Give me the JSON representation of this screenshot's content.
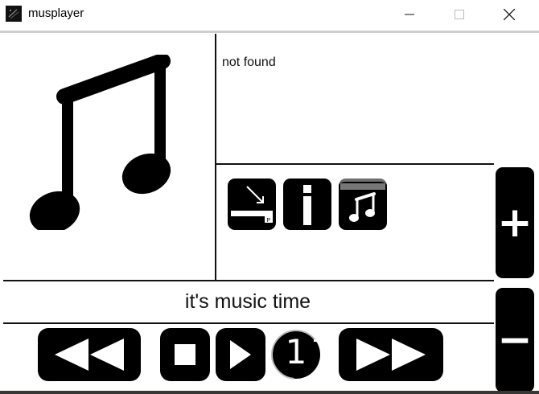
{
  "window": {
    "title": "musplayer"
  },
  "track_info": {
    "status": "not found"
  },
  "caption": "it's music time",
  "playback": {
    "counter": "1"
  },
  "side_controls": {
    "plus_label": "+",
    "minus_label": "−"
  },
  "icons": {
    "album_art": "music-note-icon",
    "open": "open-file-icon",
    "info": "info-icon",
    "playlist": "playlist-icon",
    "rewind": "rewind-icon",
    "stop": "stop-icon",
    "play": "play-icon",
    "fast_forward": "fast-forward-icon"
  },
  "colors": {
    "foreground": "#000000",
    "background": "#ffffff"
  }
}
